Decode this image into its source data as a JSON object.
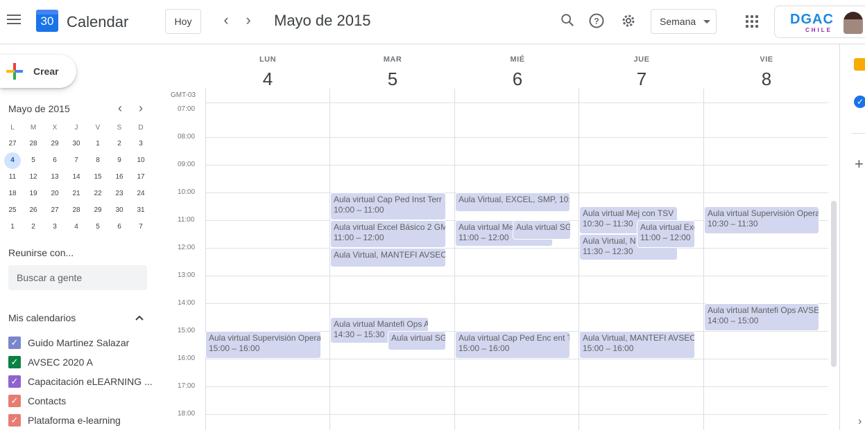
{
  "header": {
    "app_icon_number": "30",
    "app_title": "Calendar",
    "today_label": "Hoy",
    "prev_symbol": "‹",
    "next_symbol": "›",
    "period_title": "Mayo de 2015",
    "view_label": "Semana",
    "account_logo_text": "DGAC",
    "account_logo_sub": "CHILE"
  },
  "sidebar": {
    "create_label": "Crear",
    "mini_cal_title": "Mayo de 2015",
    "weekday_headers": [
      "L",
      "M",
      "X",
      "J",
      "V",
      "S",
      "D"
    ],
    "weeks": [
      [
        "27",
        "28",
        "29",
        "30",
        "1",
        "2",
        "3"
      ],
      [
        "4",
        "5",
        "6",
        "7",
        "8",
        "9",
        "10"
      ],
      [
        "11",
        "12",
        "13",
        "14",
        "15",
        "16",
        "17"
      ],
      [
        "18",
        "19",
        "20",
        "21",
        "22",
        "23",
        "24"
      ],
      [
        "25",
        "26",
        "27",
        "28",
        "29",
        "30",
        "31"
      ],
      [
        "1",
        "2",
        "3",
        "4",
        "5",
        "6",
        "7"
      ]
    ],
    "selected_day": "4",
    "meet_title": "Reunirse con...",
    "people_placeholder": "Buscar a gente",
    "my_calendars_title": "Mis calendarios",
    "calendars": [
      {
        "label": "Guido Martinez Salazar",
        "color": "#7986cb"
      },
      {
        "label": "AVSEC 2020 A",
        "color": "#0b8043"
      },
      {
        "label": "Capacitación eLEARNING ...",
        "color": "#8e63ce"
      },
      {
        "label": "Contacts",
        "color": "#e67c73"
      },
      {
        "label": "Plataforma e-learning",
        "color": "#e67c73"
      }
    ]
  },
  "week": {
    "timezone": "GMT-03",
    "days": [
      {
        "name": "LUN",
        "num": "4"
      },
      {
        "name": "MAR",
        "num": "5"
      },
      {
        "name": "MIÉ",
        "num": "6"
      },
      {
        "name": "JUE",
        "num": "7"
      },
      {
        "name": "VIE",
        "num": "8"
      }
    ],
    "hours": [
      "07:00",
      "08:00",
      "09:00",
      "10:00",
      "11:00",
      "12:00",
      "13:00",
      "14:00",
      "15:00",
      "16:00",
      "17:00",
      "18:00"
    ],
    "events": [
      {
        "title": "Aula virtual Supervisión Opera",
        "time": "15:00 – 16:00"
      },
      {
        "title": "Aula virtual Cap Ped Inst Terr",
        "time": "10:00 – 11:00"
      },
      {
        "title": "Aula virtual Excel Básico 2 GM",
        "time": "11:00 – 12:00"
      },
      {
        "title": "Aula Virtual, MANTEFI AVSEC",
        "time": ""
      },
      {
        "title": "Aula virtual Mantefi Ops A",
        "time": "14:30 – 15:30"
      },
      {
        "title": "Aula virtual SG",
        "time": ""
      },
      {
        "title": "Aula Virtual, EXCEL, SMP, 10:0",
        "time": ""
      },
      {
        "title": "Aula virtual Me",
        "time": "11:00 – 12:00"
      },
      {
        "title": "Aula virtual SG",
        "time": ""
      },
      {
        "title": "Aula virtual Cap Ped Enc ent T",
        "time": "15:00 – 16:00"
      },
      {
        "title": "Aula virtual Mej con TSV",
        "time": "10:30 – 11:30"
      },
      {
        "title": "Aula Virtual, N",
        "time": "11:30 – 12:30"
      },
      {
        "title": "Aula virtual Exc",
        "time": "11:00 – 12:00"
      },
      {
        "title": "Aula Virtual, MANTEFI AVSEC",
        "time": "15:00 – 16:00"
      },
      {
        "title": "Aula virtual Supervisión Opera",
        "time": "10:30 – 11:30"
      },
      {
        "title": "Aula virtual Mantefi Ops AVSE",
        "time": "14:00 – 15:00"
      }
    ]
  }
}
